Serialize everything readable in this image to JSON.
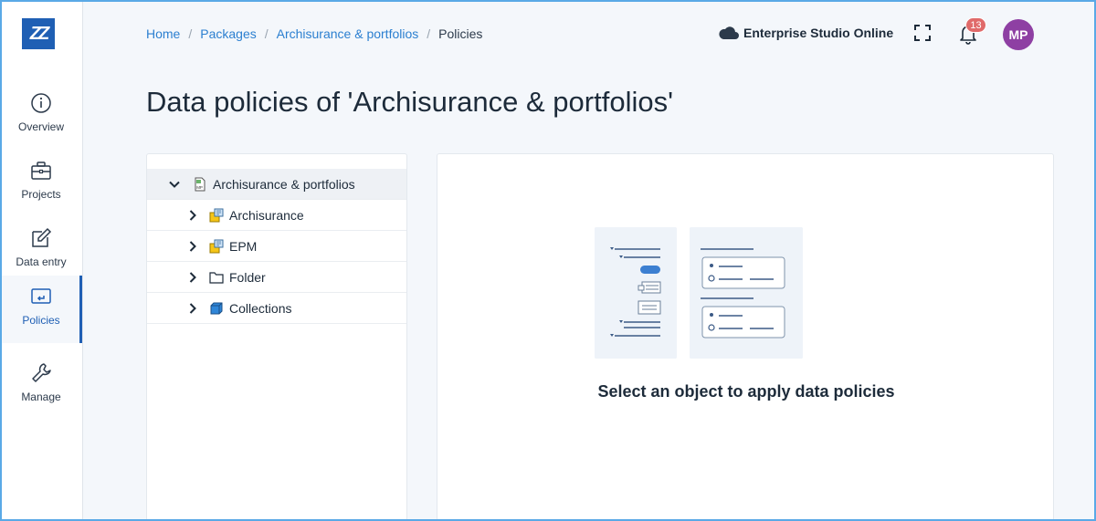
{
  "sidebar": {
    "logo": "ZZ",
    "items": [
      {
        "label": "Overview",
        "icon": "info-icon"
      },
      {
        "label": "Projects",
        "icon": "briefcase-icon"
      },
      {
        "label": "Data entry",
        "icon": "edit-icon"
      },
      {
        "label": "Policies",
        "icon": "policy-icon",
        "active": true
      },
      {
        "label": "Manage",
        "icon": "wrench-icon"
      }
    ]
  },
  "header": {
    "breadcrumb": [
      "Home",
      "Packages",
      "Archisurance & portfolios",
      "Policies"
    ],
    "studio_label": "Enterprise Studio Online",
    "notification_count": "13",
    "avatar_initials": "MP"
  },
  "page": {
    "title": "Data policies of 'Archisurance & portfolios'"
  },
  "tree": {
    "root": {
      "label": "Archisurance & portfolios",
      "icon": "model-package-icon",
      "expanded": true
    },
    "children": [
      {
        "label": "Archisurance",
        "icon": "model-icon"
      },
      {
        "label": "EPM",
        "icon": "model-icon"
      },
      {
        "label": "Folder",
        "icon": "folder-icon"
      },
      {
        "label": "Collections",
        "icon": "collection-cube-icon"
      }
    ]
  },
  "main": {
    "empty_message": "Select an object to apply data policies"
  },
  "colors": {
    "accent": "#1f5fb4",
    "link": "#2b7fd0",
    "badge": "#e06a6a",
    "avatar": "#8e3fa3"
  }
}
